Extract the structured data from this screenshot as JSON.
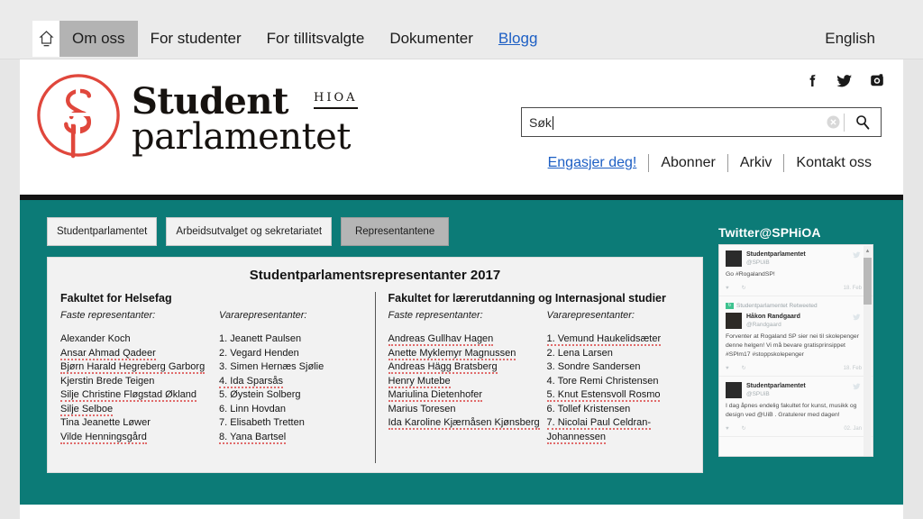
{
  "topnav": {
    "home_icon": "home-icon",
    "items": [
      {
        "label": "Om oss",
        "state": "active"
      },
      {
        "label": "For studenter",
        "state": "normal"
      },
      {
        "label": "For tillitsvalgte",
        "state": "normal"
      },
      {
        "label": "Dokumenter",
        "state": "normal"
      },
      {
        "label": "Blogg",
        "state": "link"
      }
    ],
    "language": "English"
  },
  "brand": {
    "line1": "Student",
    "line2": "parlamentet",
    "suffix": "HIOA"
  },
  "socials": [
    {
      "name": "facebook-icon"
    },
    {
      "name": "twitter-icon"
    },
    {
      "name": "instagram-icon"
    }
  ],
  "search": {
    "value": "Søk",
    "placeholder": "Søk",
    "clear_icon": "clear-circle-icon",
    "submit_icon": "magnifier-icon"
  },
  "util_links": [
    {
      "label": "Engasjer deg!",
      "style": "primary"
    },
    {
      "label": "Abonner",
      "style": "normal"
    },
    {
      "label": "Arkiv",
      "style": "normal"
    },
    {
      "label": "Kontakt oss",
      "style": "normal"
    }
  ],
  "tabs": [
    {
      "label": "Studentparlamentet",
      "active": false
    },
    {
      "label": "Arbeidsutvalget og sekretariatet",
      "active": true,
      "two_line": true
    },
    {
      "label": "Representantene",
      "active": true
    }
  ],
  "tabs_state": {
    "studentparlamentet": false,
    "arbeidsutvalget": false,
    "representantene": true
  },
  "card": {
    "title": "Studentparlamentsrepresentanter 2017",
    "columns": [
      {
        "faculty": "Fakultet for Helsefag",
        "label_faste": "Faste representanter:",
        "label_vara": "Vararepresentanter:",
        "faste": [
          "Alexander Koch",
          "Ansar Ahmad Qadeer",
          "Bjørn Harald Hegreberg Garborg",
          "Kjerstin Brede Teigen",
          "Silje Christine Fløgstad Økland",
          "Silje Selboe",
          "Tina Jeanette Løwer",
          "Vilde Henningsgård"
        ],
        "vara": [
          "1. Jeanett Paulsen",
          "2. Vegard Henden",
          "3. Simen Hernæs Sjølie",
          "4. Ida Sparsås",
          "5. Øystein Solberg",
          "6. Linn Hovdan",
          "7. Elisabeth Tretten",
          "8. Yana Bartsel"
        ]
      },
      {
        "faculty": "Fakultet for lærerutdanning og Internasjonal studier",
        "label_faste": "Faste representanter:",
        "label_vara": "Vararepresentanter:",
        "faste": [
          "Andreas Gullhav Hagen",
          "Anette Myklemyr Magnussen",
          "Andreas Hägg Bratsberg",
          "Henry Mutebe",
          "Mariulina Dietenhofer",
          "Marius Toresen",
          "Ida Karoline Kjærnåsen Kjønsberg"
        ],
        "vara": [
          "1. Vemund Haukelidsæter",
          "2. Lena Larsen",
          "3. Sondre Sandersen",
          "4. Tore Remi Christensen",
          "5. Knut Estensvoll Rosmo",
          "6. Tollef Kristensen",
          "7. Nicolai Paul Celdran-Johannessen"
        ]
      }
    ]
  },
  "twitter": {
    "title": "Twitter@SPHiOA",
    "tweets": [
      {
        "retweet_label": "",
        "name": "Studentparlamentet",
        "handle": "@SPUiB",
        "body": "Go #RogalandSP!",
        "date": "18. Feb"
      },
      {
        "retweet_label": "Studentparlamentet Retweeted",
        "name": "Håkon Randgaard",
        "handle": "@Randgaard",
        "body": "Forventer at Rogaland SP sier nei til skolepenger denne helgen! Vi må bevare gratisprinsippet #SPlm17 #stoppskolepenger",
        "date": "18. Feb"
      },
      {
        "retweet_label": "",
        "name": "Studentparlamentet",
        "handle": "@SPUiB",
        "body": "I dag åpnes endelig fakultet for kunst, musikk og design ved @UiB . Gratulerer med dagen!",
        "date": "02. Jan"
      }
    ]
  },
  "colors": {
    "teal": "#0c7b77",
    "brand_red": "#e0473c",
    "link_blue": "#1d5fc4",
    "active_tab_gray": "#b5b5b5"
  }
}
